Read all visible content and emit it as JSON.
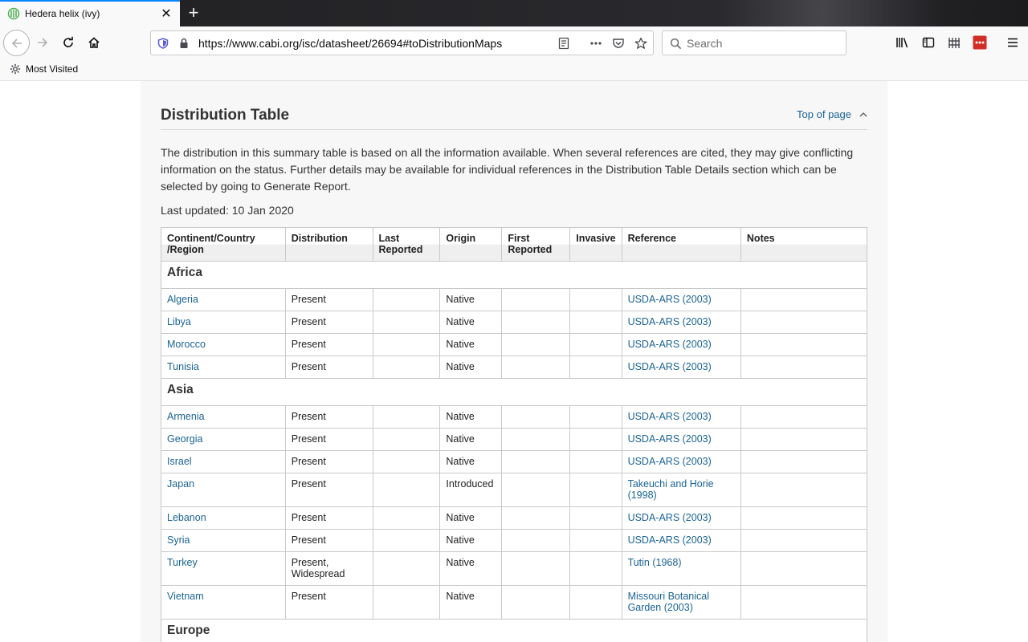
{
  "browser": {
    "tab_title": "Hedera helix (ivy)",
    "url": "https://www.cabi.org/isc/datasheet/26694#toDistributionMaps",
    "search_placeholder": "Search",
    "bookmark_label": "Most Visited",
    "close_glyph": "✕",
    "newtab_glyph": "+"
  },
  "section": {
    "title": "Distribution Table",
    "top_link": "Top of page",
    "intro": "The distribution in this summary table is based on all the information available. When several references are cited, they may give conflicting information on the status. Further details may be available for individual references in the Distribution Table Details section which can be selected by going to Generate Report.",
    "last_updated": "Last updated: 10 Jan 2020"
  },
  "table": {
    "headers": [
      "Continent/Country /Region",
      "Distribution",
      "Last Reported",
      "Origin",
      "First Reported",
      "Invasive",
      "Reference",
      "Notes"
    ],
    "regions": [
      {
        "name": "Africa",
        "rows": [
          {
            "country": "Algeria",
            "distribution": "Present",
            "last_reported": "",
            "origin": "Native",
            "first_reported": "",
            "invasive": "",
            "reference": "USDA-ARS (2003)",
            "notes": ""
          },
          {
            "country": "Libya",
            "distribution": "Present",
            "last_reported": "",
            "origin": "Native",
            "first_reported": "",
            "invasive": "",
            "reference": "USDA-ARS (2003)",
            "notes": ""
          },
          {
            "country": "Morocco",
            "distribution": "Present",
            "last_reported": "",
            "origin": "Native",
            "first_reported": "",
            "invasive": "",
            "reference": "USDA-ARS (2003)",
            "notes": ""
          },
          {
            "country": "Tunisia",
            "distribution": "Present",
            "last_reported": "",
            "origin": "Native",
            "first_reported": "",
            "invasive": "",
            "reference": "USDA-ARS (2003)",
            "notes": ""
          }
        ]
      },
      {
        "name": "Asia",
        "rows": [
          {
            "country": "Armenia",
            "distribution": "Present",
            "last_reported": "",
            "origin": "Native",
            "first_reported": "",
            "invasive": "",
            "reference": "USDA-ARS (2003)",
            "notes": ""
          },
          {
            "country": "Georgia",
            "distribution": "Present",
            "last_reported": "",
            "origin": "Native",
            "first_reported": "",
            "invasive": "",
            "reference": "USDA-ARS (2003)",
            "notes": ""
          },
          {
            "country": "Israel",
            "distribution": "Present",
            "last_reported": "",
            "origin": "Native",
            "first_reported": "",
            "invasive": "",
            "reference": "USDA-ARS (2003)",
            "notes": ""
          },
          {
            "country": "Japan",
            "distribution": "Present",
            "last_reported": "",
            "origin": "Introduced",
            "first_reported": "",
            "invasive": "",
            "reference": "Takeuchi and Horie (1998)",
            "notes": ""
          },
          {
            "country": "Lebanon",
            "distribution": "Present",
            "last_reported": "",
            "origin": "Native",
            "first_reported": "",
            "invasive": "",
            "reference": "USDA-ARS (2003)",
            "notes": ""
          },
          {
            "country": "Syria",
            "distribution": "Present",
            "last_reported": "",
            "origin": "Native",
            "first_reported": "",
            "invasive": "",
            "reference": "USDA-ARS (2003)",
            "notes": ""
          },
          {
            "country": "Turkey",
            "distribution": "Present, Widespread",
            "last_reported": "",
            "origin": "Native",
            "first_reported": "",
            "invasive": "",
            "reference": "Tutin (1968)",
            "notes": ""
          },
          {
            "country": "Vietnam",
            "distribution": "Present",
            "last_reported": "",
            "origin": "Native",
            "first_reported": "",
            "invasive": "",
            "reference": "Missouri Botanical Garden (2003)",
            "notes": ""
          }
        ]
      },
      {
        "name": "Europe",
        "rows": []
      }
    ]
  }
}
